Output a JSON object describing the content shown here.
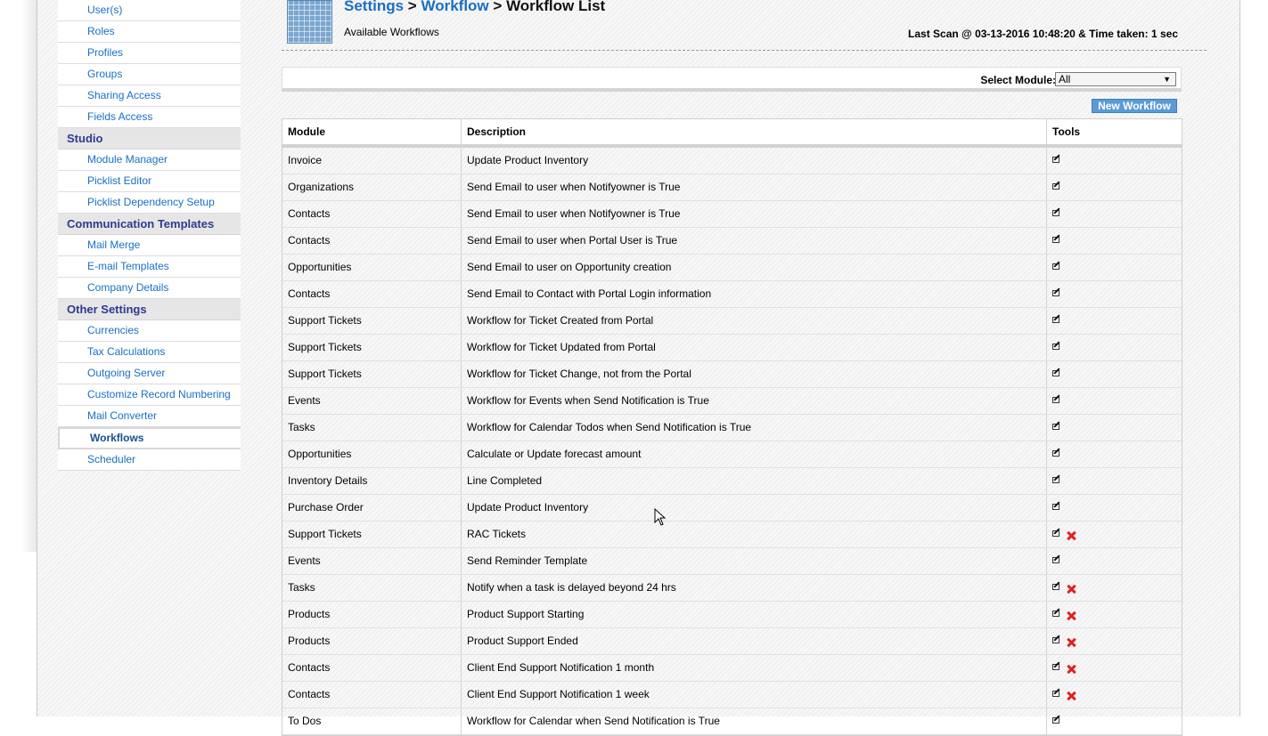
{
  "sidebar": {
    "items": [
      {
        "label": "User(s)",
        "type": "link"
      },
      {
        "label": "Roles",
        "type": "link"
      },
      {
        "label": "Profiles",
        "type": "link"
      },
      {
        "label": "Groups",
        "type": "link"
      },
      {
        "label": "Sharing Access",
        "type": "link"
      },
      {
        "label": "Fields Access",
        "type": "link"
      },
      {
        "label": "Studio",
        "type": "header"
      },
      {
        "label": "Module Manager",
        "type": "link"
      },
      {
        "label": "Picklist Editor",
        "type": "link"
      },
      {
        "label": "Picklist Dependency Setup",
        "type": "link"
      },
      {
        "label": "Communication Templates",
        "type": "header"
      },
      {
        "label": "Mail Merge",
        "type": "link"
      },
      {
        "label": "E-mail Templates",
        "type": "link"
      },
      {
        "label": "Company Details",
        "type": "link"
      },
      {
        "label": "Other Settings",
        "type": "header"
      },
      {
        "label": "Currencies",
        "type": "link"
      },
      {
        "label": "Tax Calculations",
        "type": "link"
      },
      {
        "label": "Outgoing Server",
        "type": "link"
      },
      {
        "label": "Customize Record Numbering",
        "type": "link"
      },
      {
        "label": "Mail Converter",
        "type": "link"
      },
      {
        "label": "Workflows",
        "type": "active"
      },
      {
        "label": "Scheduler",
        "type": "link"
      }
    ]
  },
  "header": {
    "crumb_settings": "Settings",
    "crumb_workflow": "Workflow",
    "crumb_current": "Workflow List",
    "separator": ">",
    "subtitle": "Available Workflows",
    "last_scan": "Last Scan @ 03-13-2016 10:48:20 & Time taken: 1 sec",
    "icon": "settings-grid-icon"
  },
  "filter": {
    "label": "Select Module:",
    "selected": "All"
  },
  "toolbar": {
    "new_workflow_label": "New Workflow"
  },
  "table": {
    "headers": [
      "Module",
      "Description",
      "Tools"
    ],
    "rows": [
      {
        "module": "Invoice",
        "description": "Update Product Inventory",
        "deletable": false
      },
      {
        "module": "Organizations",
        "description": "Send Email to user when Notifyowner is True",
        "deletable": false
      },
      {
        "module": "Contacts",
        "description": "Send Email to user when Notifyowner is True",
        "deletable": false
      },
      {
        "module": "Contacts",
        "description": "Send Email to user when Portal User is True",
        "deletable": false
      },
      {
        "module": "Opportunities",
        "description": "Send Email to user on Opportunity creation",
        "deletable": false
      },
      {
        "module": "Contacts",
        "description": "Send Email to Contact with Portal Login information",
        "deletable": false
      },
      {
        "module": "Support Tickets",
        "description": "Workflow for Ticket Created from Portal",
        "deletable": false
      },
      {
        "module": "Support Tickets",
        "description": "Workflow for Ticket Updated from Portal",
        "deletable": false
      },
      {
        "module": "Support Tickets",
        "description": "Workflow for Ticket Change, not from the Portal",
        "deletable": false
      },
      {
        "module": "Events",
        "description": "Workflow for Events when Send Notification is True",
        "deletable": false
      },
      {
        "module": "Tasks",
        "description": "Workflow for Calendar Todos when Send Notification is True",
        "deletable": false
      },
      {
        "module": "Opportunities",
        "description": "Calculate or Update forecast amount",
        "deletable": false
      },
      {
        "module": "Inventory Details",
        "description": "Line Completed",
        "deletable": false
      },
      {
        "module": "Purchase Order",
        "description": "Update Product Inventory",
        "deletable": false
      },
      {
        "module": "Support Tickets",
        "description": "RAC Tickets",
        "deletable": true
      },
      {
        "module": "Events",
        "description": "Send Reminder Template",
        "deletable": false
      },
      {
        "module": "Tasks",
        "description": "Notify when a task is delayed beyond 24 hrs",
        "deletable": true
      },
      {
        "module": "Products",
        "description": "Product Support Starting",
        "deletable": true
      },
      {
        "module": "Products",
        "description": "Product Support Ended",
        "deletable": true
      },
      {
        "module": "Contacts",
        "description": "Client End Support Notification 1 month",
        "deletable": true
      },
      {
        "module": "Contacts",
        "description": "Client End Support Notification 1 week",
        "deletable": true
      },
      {
        "module": "To Dos",
        "description": "Workflow for Calendar when Send Notification is True",
        "deletable": false
      }
    ]
  },
  "colors": {
    "link": "#1a6fc4",
    "section_header": "#2d3b8f",
    "button_bg": "#5b9bd5",
    "delete_icon": "#e02020"
  }
}
